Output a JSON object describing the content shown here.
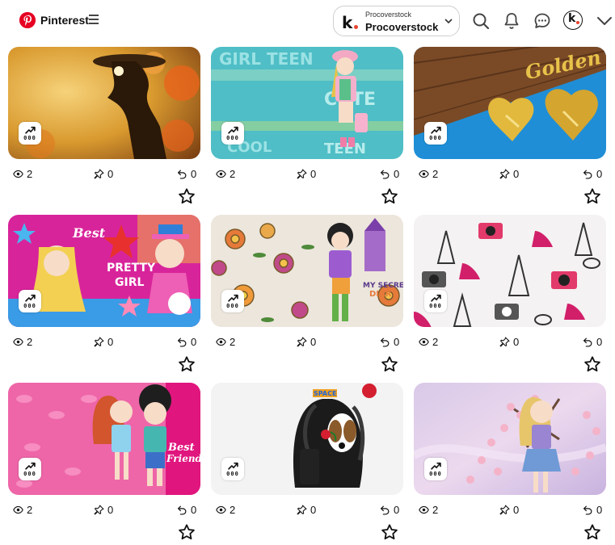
{
  "header": {
    "brand": "Pinterest",
    "account": {
      "label_small": "Procoverstock",
      "label_big": "Procoverstock",
      "logo_letter": "k"
    },
    "avatar_letter": "k",
    "icons": [
      "search-icon",
      "bell-icon",
      "chat-icon",
      "chevron-down-icon"
    ]
  },
  "colors": {
    "brand_red": "#e60023",
    "accent_dot": "#e8432f"
  },
  "pins": [
    {
      "views": "2",
      "saves": "0",
      "repins": "0",
      "image": "woman-in-hat-silhouette-golden-floral"
    },
    {
      "views": "2",
      "saves": "0",
      "repins": "0",
      "image": "cute-teen-girl-teal-pattern"
    },
    {
      "views": "2",
      "saves": "0",
      "repins": "0",
      "image": "golden-hearts-on-wood"
    },
    {
      "views": "2",
      "saves": "0",
      "repins": "0",
      "image": "pretty-girl-cat-pink-stars"
    },
    {
      "views": "2",
      "saves": "0",
      "repins": "0",
      "image": "girl-secret-diary-flowers"
    },
    {
      "views": "2",
      "saves": "0",
      "repins": "0",
      "image": "paris-cameras-shoes-pattern"
    },
    {
      "views": "2",
      "saves": "0",
      "repins": "0",
      "image": "best-friends-girls-pink"
    },
    {
      "views": "2",
      "saves": "0",
      "repins": "0",
      "image": "dog-with-curly-wig-rose"
    },
    {
      "views": "2",
      "saves": "0",
      "repins": "0",
      "image": "girl-cherry-blossom-lilac"
    }
  ]
}
